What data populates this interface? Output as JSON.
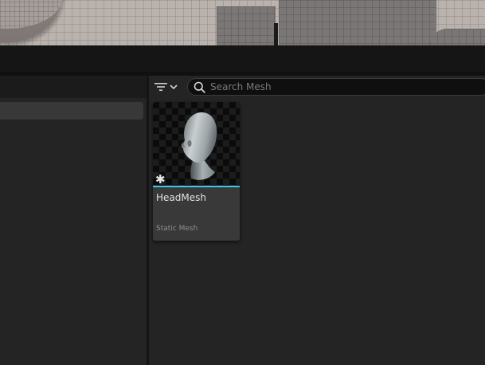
{
  "search": {
    "placeholder": "Search Mesh",
    "value": ""
  },
  "toolbar": {
    "filter_icon": "filter-icon",
    "dropdown_icon": "chevron-down-icon"
  },
  "assets": [
    {
      "name": "HeadMesh",
      "type": "Static Mesh",
      "thumbnail": "head-mesh-thumbnail",
      "badge_icon": "asterisk-icon",
      "type_color": "#3fc9e6"
    }
  ],
  "colors": {
    "panel_bg": "#242424",
    "accent_static_mesh": "#3fc9e6"
  }
}
